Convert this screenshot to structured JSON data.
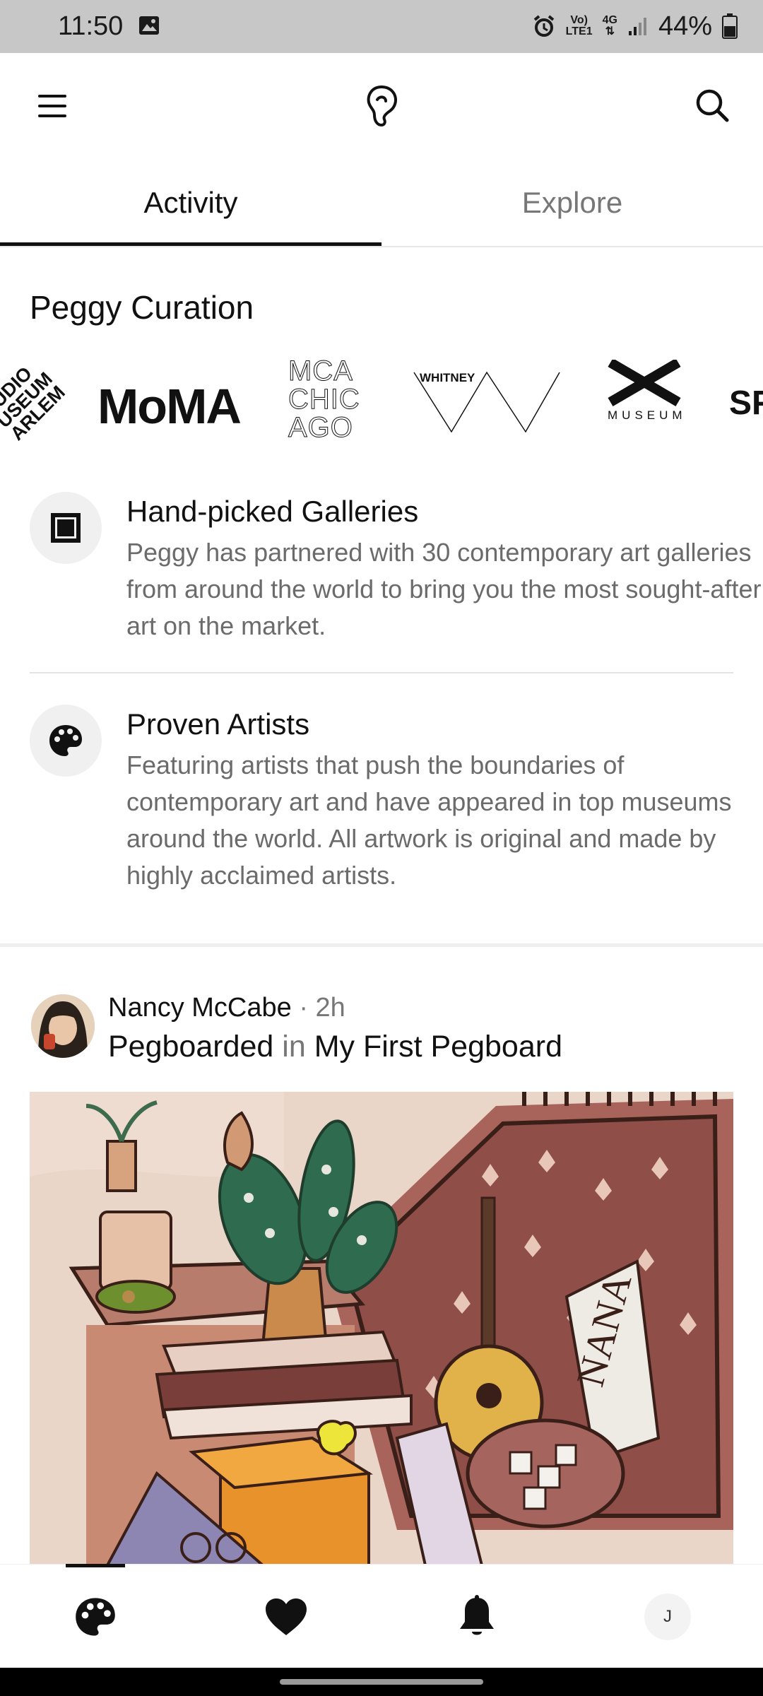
{
  "status_bar": {
    "time": "11:50",
    "network_top": "Vo)",
    "network_sub": "LTE1",
    "net_type": "4G",
    "battery": "44%"
  },
  "header": {
    "menu_icon": "hamburger-menu-icon",
    "logo_icon": "peggy-logo-icon",
    "search_icon": "search-icon"
  },
  "tabs": [
    {
      "label": "Activity",
      "active": true
    },
    {
      "label": "Explore",
      "active": false
    }
  ],
  "curation": {
    "title": "Peggy Curation",
    "logos": {
      "studio_museum": [
        "UDIO",
        "USEUM",
        "ARLEM"
      ],
      "moma": "MoMA",
      "mca": [
        "MCA",
        "CHIC",
        "AGO"
      ],
      "whitney": "WHITNEY",
      "museum_x": "MUSEUM",
      "sf": "SF"
    },
    "features": [
      {
        "icon": "gallery-frame-icon",
        "title": "Hand-picked Galleries",
        "body": "Peggy has partnered with 30 contemporary art galleries from around the world to bring you the most sought-after art on the market."
      },
      {
        "icon": "palette-icon",
        "title": "Proven Artists",
        "body": "Featuring artists that push the boundaries of contemporary art and have appeared in top museums around the world. All artwork is original and made by highly acclaimed artists."
      }
    ]
  },
  "post": {
    "user": "Nancy McCabe",
    "meta": " · 2h",
    "action": "Pegboarded",
    "in_word": " in ",
    "board": "My First Pegboard",
    "artwork_text": "NANA"
  },
  "bottom_nav": {
    "items": [
      "palette-icon",
      "heart-icon",
      "bell-icon",
      "profile-avatar"
    ],
    "profile_initial": "J"
  },
  "colors": {
    "accent": "#111111",
    "muted_text": "#6b6b6b",
    "status_bar_bg": "#c7c7c7"
  }
}
